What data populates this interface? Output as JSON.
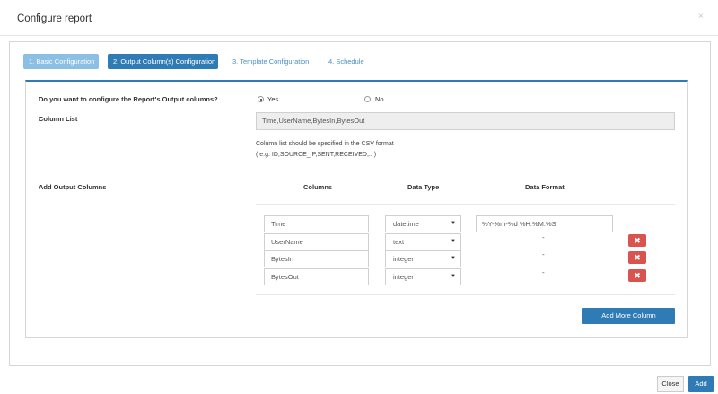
{
  "modal": {
    "title": "Configure report",
    "close_glyph": "×"
  },
  "steps": [
    {
      "label": "1. Basic Configuration"
    },
    {
      "label": "2. Output Column(s) Configuration"
    },
    {
      "label": "3. Template Configuration"
    },
    {
      "label": "4. Schedule"
    }
  ],
  "form": {
    "question_label": "Do you want to configure the Report's Output columns?",
    "option_yes": "Yes",
    "option_no": "No",
    "selected_option": "Yes",
    "column_list_label": "Column List",
    "column_list_value": "Time,UserName,BytesIn,BytesOut",
    "help_line_1": "Column list should be specified in the CSV format",
    "help_line_2": "( e.g. ID,SOURCE_IP,SENT,RECEIVED,.. )",
    "add_output_columns_label": "Add Output Columns",
    "headers": {
      "columns": "Columns",
      "data_type": "Data Type",
      "data_format": "Data Format"
    },
    "rows": [
      {
        "name": "Time",
        "type": "datetime",
        "format": "%Y-%m-%d %H:%M:%S"
      },
      {
        "name": "UserName",
        "type": "text",
        "format": "-"
      },
      {
        "name": "BytesIn",
        "type": "integer",
        "format": "-"
      },
      {
        "name": "BytesOut",
        "type": "integer",
        "format": "-"
      }
    ],
    "add_more_label": "Add More Column",
    "delete_glyph": "✖",
    "caret_glyph": "▼"
  },
  "footer": {
    "close_label": "Close",
    "add_label": "Add"
  },
  "colors": {
    "primary": "#2f7bb5",
    "step_done": "#8bbfe3",
    "danger": "#d9534f"
  }
}
